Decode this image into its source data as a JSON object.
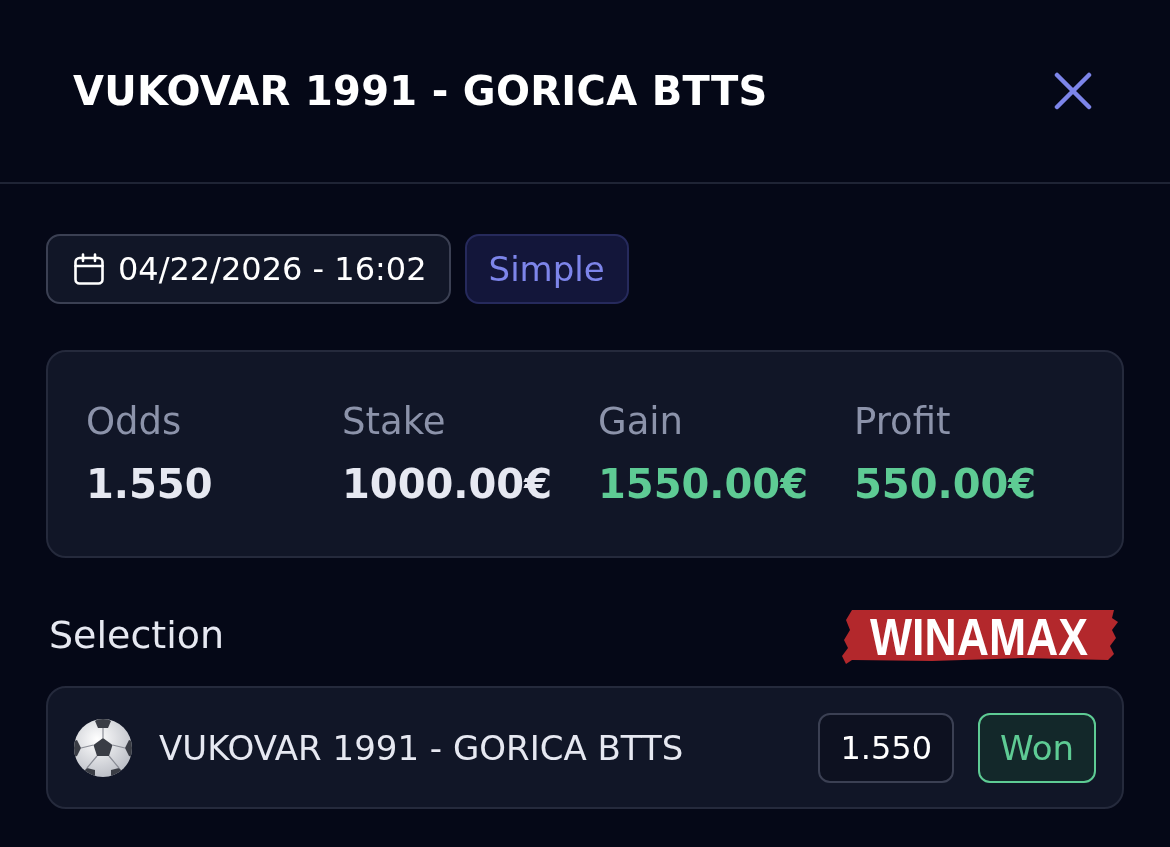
{
  "header": {
    "title": "VUKOVAR 1991 - GORICA BTTS"
  },
  "meta": {
    "date": "04/22/2026 - 16:02",
    "bet_type": "Simple"
  },
  "stats": [
    {
      "label": "Odds",
      "value": "1.550",
      "color": "#e6e8f1"
    },
    {
      "label": "Stake",
      "value": "1000.00€",
      "color": "#e6e8f1"
    },
    {
      "label": "Gain",
      "value": "1550.00€",
      "color": "#5ecb94"
    },
    {
      "label": "Profit",
      "value": "550.00€",
      "color": "#5ecb94"
    }
  ],
  "selection": {
    "heading": "Selection",
    "bookmaker": "WINAMAX",
    "items": [
      {
        "kind": "football",
        "name": "VUKOVAR 1991 - GORICA BTTS",
        "odds": "1.550",
        "status": "Won",
        "won": true
      }
    ]
  }
}
